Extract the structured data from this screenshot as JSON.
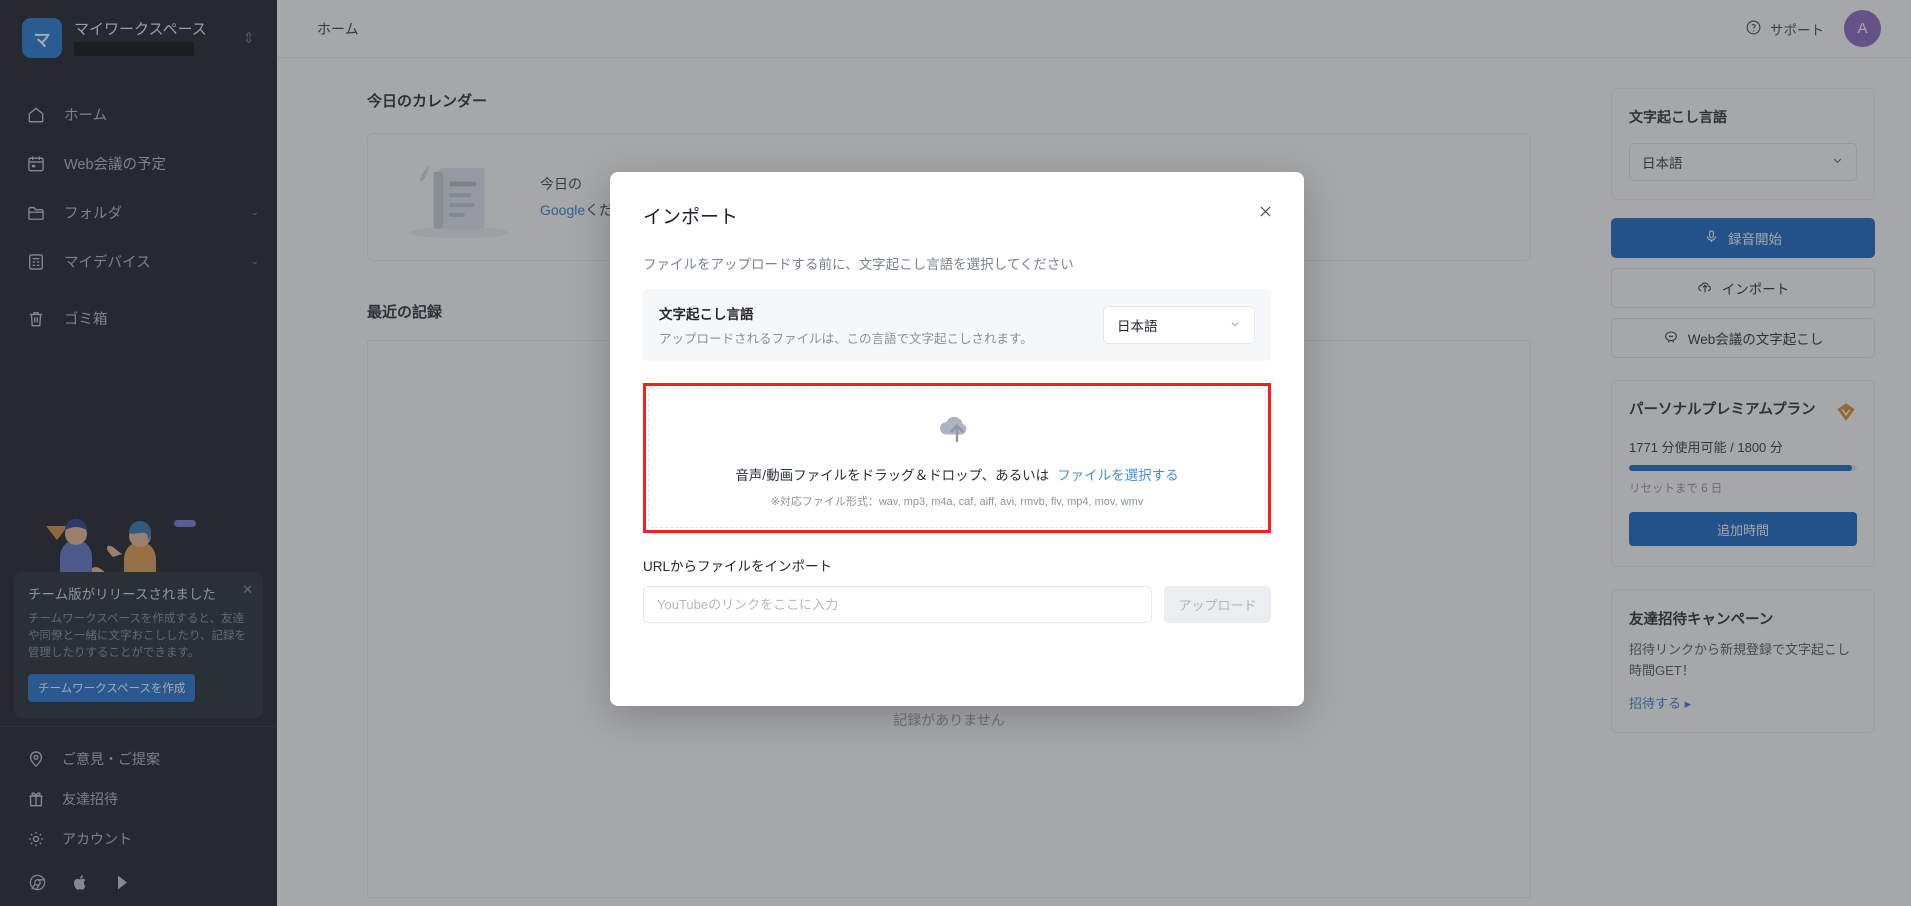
{
  "sidebar": {
    "workspace": {
      "avatar_letter": "マ",
      "name": "マイワークスペース",
      "switch_icon": "swap-vertical-icon"
    },
    "items": [
      {
        "label": "ホーム",
        "icon": "home-icon",
        "chevron": ""
      },
      {
        "label": "Web会議の予定",
        "icon": "calendar-icon",
        "chevron": ""
      },
      {
        "label": "フォルダ",
        "icon": "folder-icon",
        "chevron": "⌄"
      },
      {
        "label": "マイデバイス",
        "icon": "device-icon",
        "chevron": "⌄"
      },
      {
        "label": "ゴミ箱",
        "icon": "trash-icon",
        "chevron": ""
      }
    ],
    "promo": {
      "title": "チーム版がリリースされました",
      "body": "チームワークスペースを作成すると、友達や同僚と一緒に文字おこししたり、記録を管理したりすることができます。",
      "button": "チームワークスペースを作成",
      "close_icon": "close-icon"
    },
    "footer_items": [
      {
        "label": "ご意見・ご提案",
        "icon": "lightbulb-pin-icon"
      },
      {
        "label": "友達招待",
        "icon": "gift-icon"
      },
      {
        "label": "アカウント",
        "icon": "gear-icon"
      }
    ],
    "stores": [
      "chrome-icon",
      "apple-icon",
      "google-play-icon"
    ]
  },
  "topbar": {
    "breadcrumb": "ホーム",
    "support_label": "サポート",
    "support_icon": "question-circle-icon",
    "avatar_letter": "A"
  },
  "main": {
    "calendar_section_title": "今日のカレンダー",
    "calendar_card": {
      "line1_prefix": "今日の",
      "link_text": "Google",
      "line1_suffix": "ください。",
      "illustration": "document-illustration"
    },
    "recent_section_title": "最近の記録",
    "empty_text": "記録がありません",
    "empty_illustration": "empty-document-illustration"
  },
  "right_panel": {
    "lang_card": {
      "title": "文字起こし言語",
      "selected": "日本語",
      "chevron_icon": "chevron-down-icon"
    },
    "actions": [
      {
        "label": "録音開始",
        "icon": "microphone-icon",
        "style": "primary"
      },
      {
        "label": "インポート",
        "icon": "cloud-upload-icon",
        "style": "outline"
      },
      {
        "label": "Web会議の文字起こし",
        "icon": "meeting-icon",
        "style": "outline"
      }
    ],
    "plan": {
      "name": "パーソナルプレミアムプラン",
      "badge_icon": "premium-diamond-icon",
      "usage": "1771 分使用可能 / 1800 分",
      "progress_percent": 98,
      "reset": "リセットまで 6 日",
      "button": "追加時間"
    },
    "referral": {
      "title": "友達招待キャンペーン",
      "body": "招待リンクから新規登録で文字起こし時間GET！",
      "link": "招待する ▸"
    }
  },
  "modal": {
    "title": "インポート",
    "close_icon": "close-icon",
    "subtitle": "ファイルをアップロードする前に、文字起こし言語を選択してください",
    "lang_row": {
      "label": "文字起こし言語",
      "description": "アップロードされるファイルは、この言語で文字起こしされます。",
      "selected": "日本語",
      "chevron_icon": "chevron-down-icon"
    },
    "dropzone": {
      "icon": "cloud-upload-icon",
      "main_text": "音声/動画ファイルをドラッグ＆ドロップ、あるいは",
      "pick_link": "ファイルを選択する",
      "formats_note": "※対応ファイル形式：wav, mp3, m4a, caf, aiff, avi, rmvb, flv, mp4, mov, wmv",
      "highlight_color": "#f41f1f"
    },
    "url_section": {
      "label": "URLからファイルをインポート",
      "input_placeholder": "YouTubeのリンクをここに入力",
      "input_value": "",
      "upload_button": "アップロード"
    }
  },
  "colors": {
    "brand_blue": "#0b62c4",
    "sidebar_bg": "#13171f",
    "link_blue": "#2a7fd4",
    "highlight_red": "#f41f1f",
    "avatar_purple": "#8a63c7"
  }
}
